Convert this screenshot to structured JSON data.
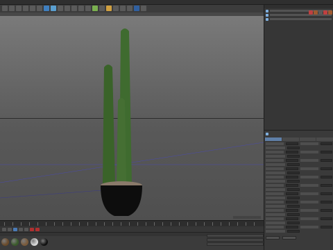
{
  "toolbar": {
    "tool_colors": [
      "#5a5a5a",
      "#5a5a5a",
      "#5a5a5a",
      "#5a5a5a",
      "#5a5a5a",
      "#5a5a5a",
      "#3f7fbf",
      "#5a9fd0",
      "#5a5a5a",
      "#5a5a5a",
      "#5a5a5a",
      "#5a5a5a",
      "#5a5a5a",
      "#7ab04f",
      "#5a5a5a",
      "#d0a040",
      "#5a5a5a",
      "#5a5a5a",
      "#5a5a5a",
      "#3060a0",
      "#5a5a5a"
    ]
  },
  "object_manager": {
    "rows": [
      {
        "name": "",
        "icon": "null-object-icon"
      },
      {
        "name": "",
        "icon": "polygon-object-icon"
      },
      {
        "name": "",
        "icon": "polygon-object-icon"
      }
    ],
    "tag_colors": [
      "#c04040",
      "#a05a30",
      "#5a5a5a",
      "#c04040",
      "#a05a30",
      "#5a5a5a"
    ]
  },
  "attributes": {
    "title": ""
  },
  "materials": {
    "colors": [
      "#6a4a2a",
      "#3a5a2a",
      "#7a5a3a",
      "#d8d8d8",
      "#101010"
    ]
  },
  "colors": {
    "pot": "#0d0d0d",
    "soil": "#8a7a6a",
    "cactus": "#3f6b2f",
    "viewport_top": "#7a7a7a",
    "viewport_bottom": "#4f4f4f",
    "accent": "#4a7bb7"
  }
}
